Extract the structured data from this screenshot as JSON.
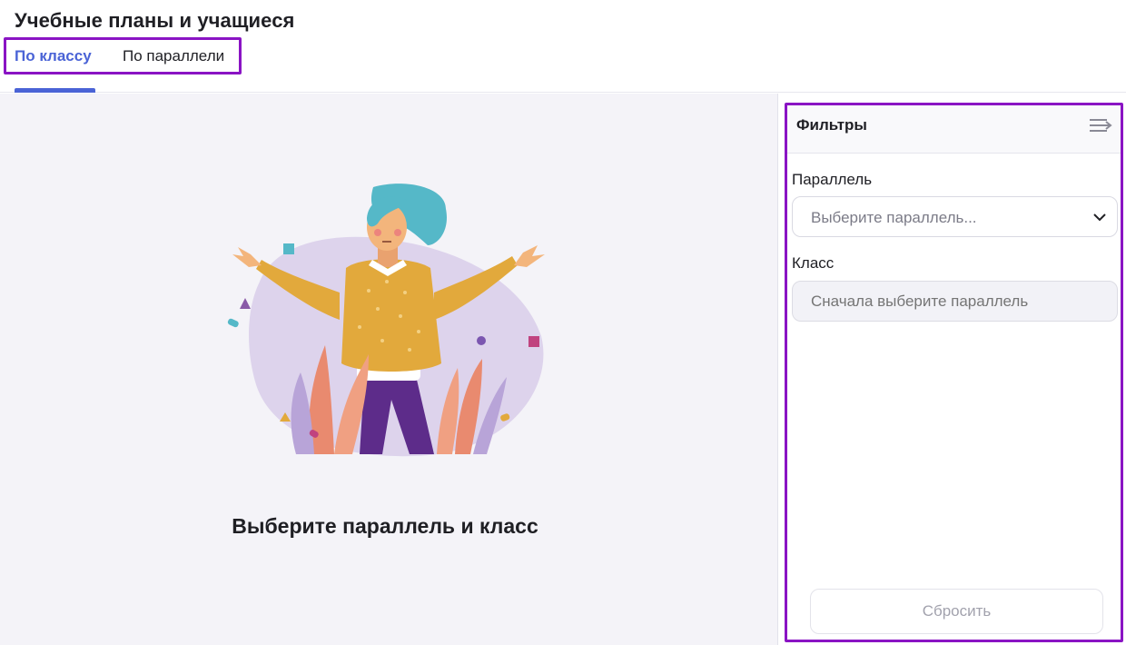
{
  "header": {
    "title": "Учебные планы и учащиеся",
    "tabs": [
      {
        "label": "По классу",
        "active": true
      },
      {
        "label": "По параллели",
        "active": false
      }
    ]
  },
  "main": {
    "empty_state_title": "Выберите параллель и класс",
    "illustration": "person-with-plants-illustration"
  },
  "filters": {
    "title": "Фильтры",
    "collapse_icon": "collapse-panel-icon",
    "parallel": {
      "label": "Параллель",
      "placeholder": "Выберите параллель...",
      "icon": "chevron-down-icon"
    },
    "class": {
      "label": "Класс",
      "placeholder": "Сначала выберите параллель"
    },
    "reset_label": "Сбросить"
  },
  "colors": {
    "accent": "#4a63d6",
    "highlight_outline": "#8a14c4",
    "main_background": "#f4f3f8"
  }
}
